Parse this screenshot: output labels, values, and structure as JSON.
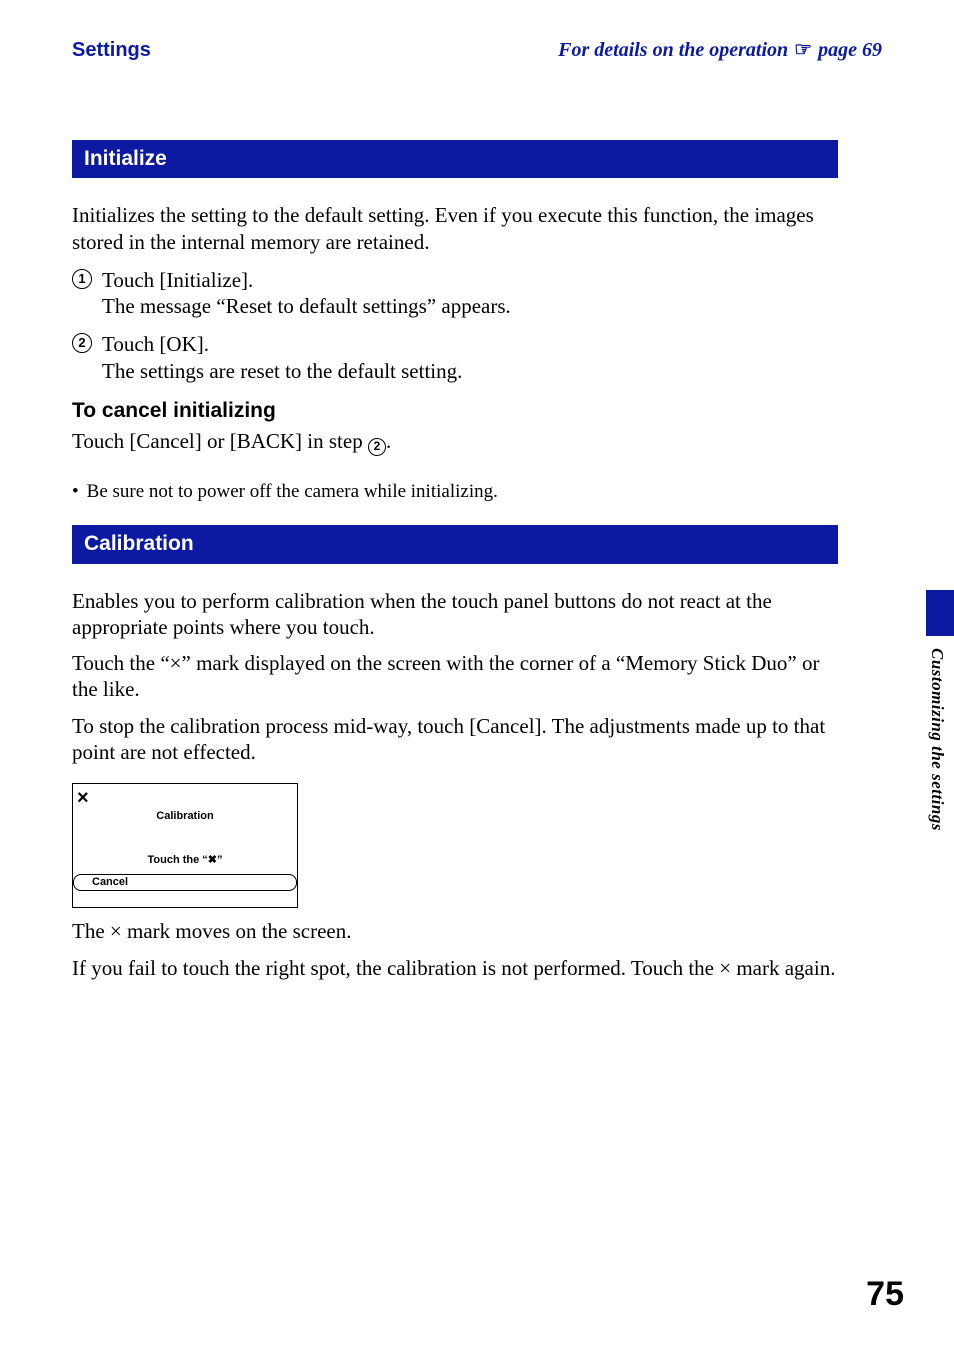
{
  "header": {
    "left": "Settings",
    "right_prefix": "For details on the operation",
    "right_suffix": "page 69"
  },
  "sections": {
    "initialize": {
      "title": "Initialize",
      "intro": "Initializes the setting to the default setting. Even if you execute this function, the images stored in the internal memory are retained.",
      "steps": [
        {
          "n": "1",
          "line1": "Touch [Initialize].",
          "line2": "The message “Reset to default settings” appears."
        },
        {
          "n": "2",
          "line1": "Touch [OK].",
          "line2": "The settings are reset to the default setting."
        }
      ],
      "cancel_head": "To cancel initializing",
      "cancel_body_a": "Touch [Cancel] or [BACK] in step ",
      "cancel_body_b": ".",
      "cancel_step_ref": "2",
      "bullet": "Be sure not to power off the camera while initializing."
    },
    "calibration": {
      "title": "Calibration",
      "p1": "Enables you to perform calibration when the touch panel buttons do not react at the appropriate points where you touch.",
      "p2": "Touch the “×” mark displayed on the screen with the corner of a “Memory Stick Duo” or the like.",
      "p3": "To stop the calibration process mid-way, touch [Cancel]. The adjustments made up to that point are not effected.",
      "screen": {
        "x": "×",
        "title": "Calibration",
        "msg": "Touch the  “✖”",
        "btn": "Cancel"
      },
      "after1": "The × mark moves on the screen.",
      "after2": "If you fail to touch the right spot, the calibration is not performed. Touch the × mark again."
    }
  },
  "side_label": "Customizing the settings",
  "page_number": "75"
}
